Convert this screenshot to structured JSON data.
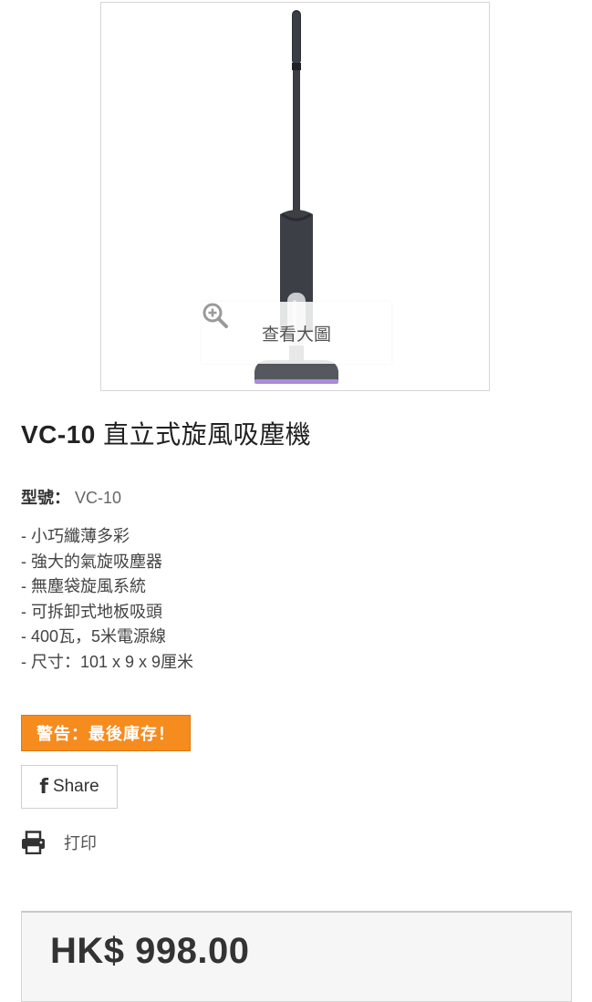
{
  "product": {
    "image_alt": "VC-10 直立式旋風吸塵機",
    "zoom_label": "查看大圖",
    "title_model": "VC-10",
    "title_name": "直立式旋風吸塵機",
    "reference_label": "型號：",
    "reference_value": "VC-10",
    "features": [
      "- 小巧纖薄多彩",
      "- 強大的氣旋吸塵器",
      "- 無塵袋旋風系統",
      "- 可拆卸式地板吸頭",
      "- 400瓦，5米電源線",
      "- 尺寸：101 x 9 x 9厘米"
    ],
    "stock_warning": "警告：最後庫存！",
    "share_label": "Share",
    "print_label": "打印",
    "price": "HK$ 998.00"
  },
  "colors": {
    "badge": "#f68b1e",
    "vacuum_body": "#3c3f45",
    "vacuum_accent": "#a98bd6"
  },
  "icons": {
    "zoom": "magnifier-plus-icon",
    "share": "facebook-icon",
    "print": "printer-icon"
  }
}
